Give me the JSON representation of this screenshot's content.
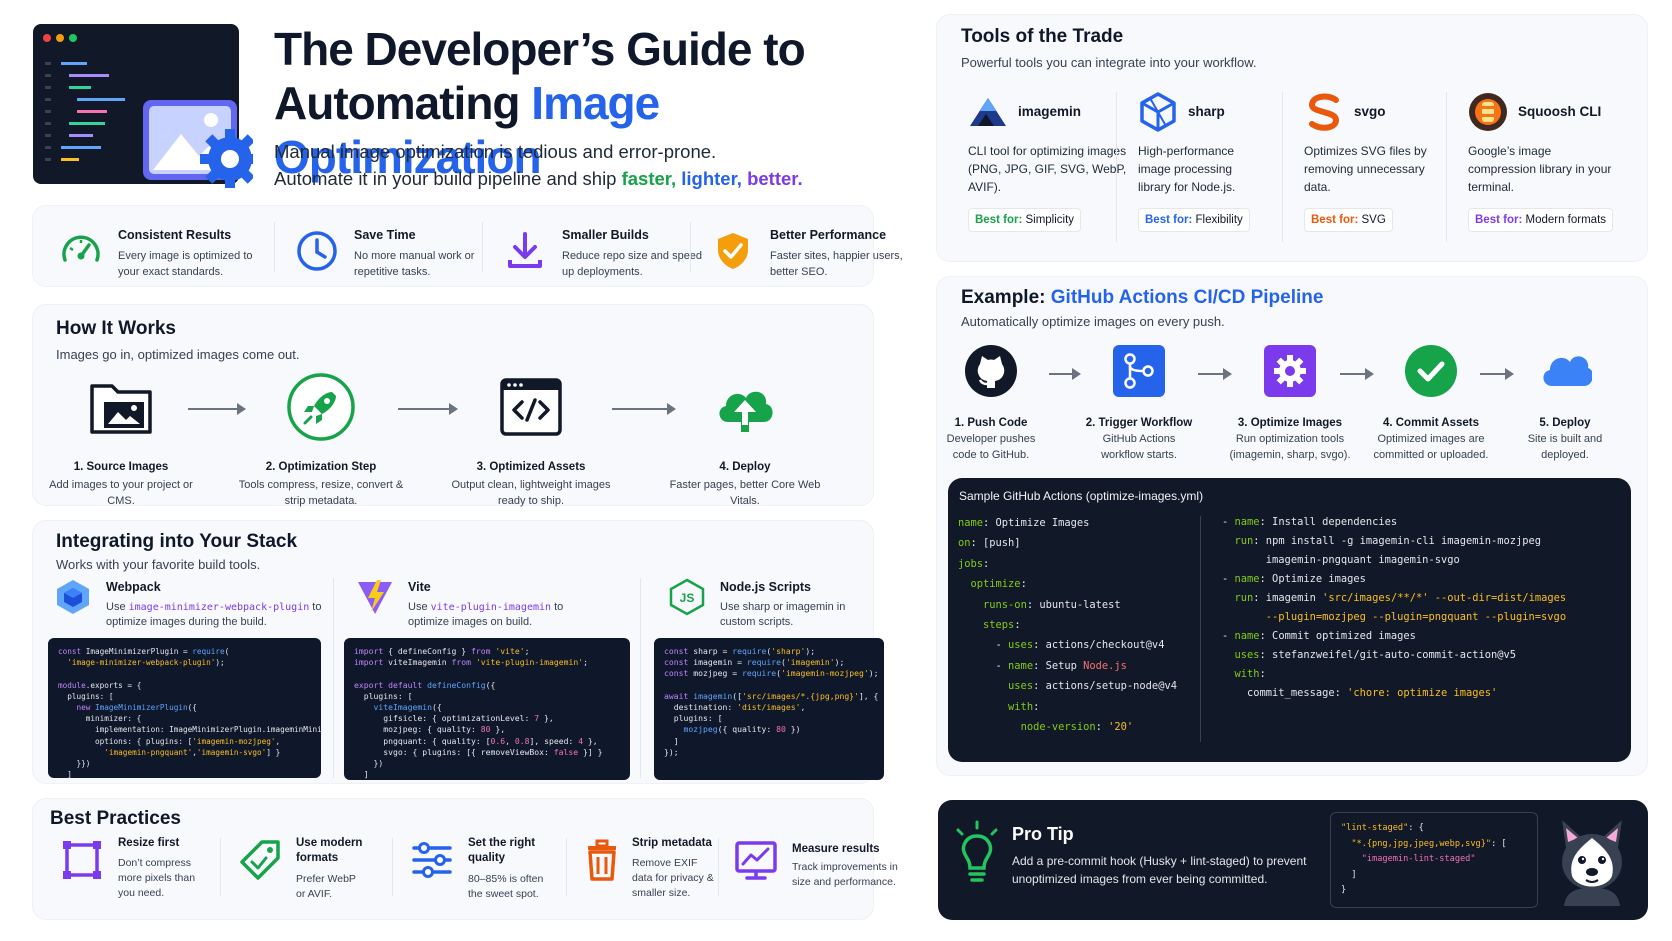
{
  "hero": {
    "title_line1": "The Developer’s Guide to",
    "title_line2_plain": "Automating ",
    "title_line2_accent": "Image Optimization",
    "sub_line1": "Manual image optimization is tedious and error-prone.",
    "sub_line2_prefix": "Automate it in your build pipeline and ship ",
    "word_faster": "faster,",
    "word_lighter": "lighter,",
    "word_better": "better."
  },
  "benefits": [
    {
      "icon": "gauge-icon",
      "title": "Consistent Results",
      "desc": "Every image is optimized to your exact standards."
    },
    {
      "icon": "clock-icon",
      "title": "Save Time",
      "desc": "No more manual work or repetitive tasks."
    },
    {
      "icon": "download-icon",
      "title": "Smaller Builds",
      "desc": "Reduce repo size and speed up deployments."
    },
    {
      "icon": "shield-check-icon",
      "title": "Better Performance",
      "desc": "Faster sites, happier users, better SEO."
    }
  ],
  "how": {
    "title": "How It Works",
    "sub": "Images go in, optimized images come out.",
    "steps": [
      {
        "icon": "folder-image-icon",
        "title": "1. Source Images",
        "desc": "Add images to your project or CMS."
      },
      {
        "icon": "rocket-icon",
        "title": "2. Optimization Step",
        "desc": "Tools compress, resize, convert & strip metadata."
      },
      {
        "icon": "code-window-icon",
        "title": "3. Optimized Assets",
        "desc": "Output clean, lightweight images ready to ship."
      },
      {
        "icon": "cloud-upload-icon",
        "title": "4. Deploy",
        "desc": "Faster pages, better Core Web Vitals."
      }
    ]
  },
  "stack": {
    "title": "Integrating into Your Stack",
    "sub": "Works with your favorite build tools.",
    "webpack": {
      "title": "Webpack",
      "desc_pre": "Use ",
      "code": "image-minimizer-webpack-plugin",
      "desc_post": " to optimize images during the build."
    },
    "vite": {
      "title": "Vite",
      "desc_pre": "Use ",
      "code": "vite-plugin-imagemin",
      "desc_post": " to optimize images on build."
    },
    "node": {
      "title": "Node.js Scripts",
      "desc": "Use sharp or imagemin in custom scripts."
    }
  },
  "best": {
    "title": "Best Practices",
    "items": [
      {
        "icon": "crop-icon",
        "title": "Resize first",
        "desc": "Don’t compress more pixels than you need."
      },
      {
        "icon": "tag-icon",
        "title": "Use modern formats",
        "desc": "Prefer WebP or AVIF."
      },
      {
        "icon": "sliders-icon",
        "title": "Set the right quality",
        "desc": "80–85% is often the sweet spot."
      },
      {
        "icon": "trash-icon",
        "title": "Strip metadata",
        "desc": "Remove EXIF data for privacy & smaller size."
      },
      {
        "icon": "chart-monitor-icon",
        "title": "Measure results",
        "desc": "Track improvements in size and performance."
      }
    ]
  },
  "tools": {
    "title": "Tools of the Trade",
    "sub": "Powerful tools you can integrate into your workflow.",
    "best_for_label": "Best for:",
    "items": [
      {
        "icon": "imagemin-icon",
        "name": "imagemin",
        "desc": "CLI tool for optimizing images (PNG, JPG, GIF, SVG, WebP, AVIF).",
        "best": "Simplicity",
        "color": "#16a34a"
      },
      {
        "icon": "sharp-cube-icon",
        "name": "sharp",
        "desc": "High-performance image processing library for Node.js.",
        "best": "Flexibility",
        "color": "#2563eb"
      },
      {
        "icon": "svgo-icon",
        "name": "svgo",
        "desc": "Optimizes SVG files by removing unnecessary data.",
        "best": "SVG",
        "color": "#ea580c"
      },
      {
        "icon": "squoosh-icon",
        "name": "Squoosh CLI",
        "desc": "Google’s image compression library in your terminal.",
        "best": "Modern formats",
        "color": "#7c3aed"
      }
    ]
  },
  "pipeline": {
    "title_plain": "Example: ",
    "title_accent": "GitHub Actions CI/CD Pipeline",
    "sub": "Automatically optimize images on every push.",
    "steps": [
      {
        "icon": "github-icon",
        "title": "1. Push Code",
        "desc": "Developer pushes code to GitHub."
      },
      {
        "icon": "workflow-icon",
        "title": "2. Trigger Workflow",
        "desc": "GitHub Actions workflow starts."
      },
      {
        "icon": "gear-icon",
        "title": "3. Optimize Images",
        "desc": "Run optimization tools (imagemin, sharp, svgo)."
      },
      {
        "icon": "check-circle-icon",
        "title": "4. Commit Assets",
        "desc": "Optimized images are committed or uploaded."
      },
      {
        "icon": "cloud-icon",
        "title": "5. Deploy",
        "desc": "Site is built and deployed."
      }
    ]
  },
  "workflow": {
    "title": "Sample GitHub Actions (optimize-images.yml)"
  },
  "protip": {
    "title": "Pro Tip",
    "desc": "Add a pre-commit hook (Husky + lint-staged) to prevent unoptimized images from ever being committed."
  },
  "colors": {
    "accent_blue": "#2563eb",
    "green": "#16a34a",
    "purple": "#7c3aed",
    "navy": "#111827"
  }
}
